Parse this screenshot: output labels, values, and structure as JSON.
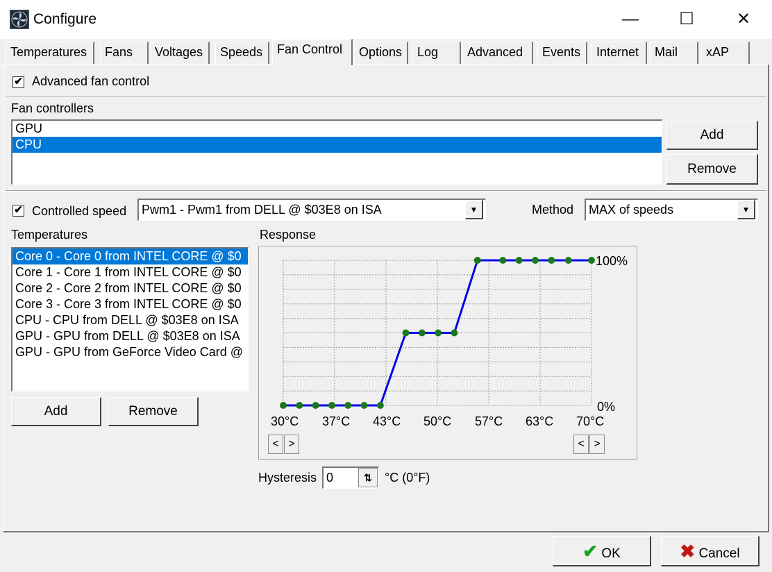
{
  "window": {
    "title": "Configure",
    "min_glyph": "—",
    "max_glyph": "☐",
    "close_glyph": "✕"
  },
  "tabs": [
    {
      "label": "Temperatures"
    },
    {
      "label": "Fans"
    },
    {
      "label": "Voltages"
    },
    {
      "label": "Speeds"
    },
    {
      "label": "Fan Control",
      "active": true
    },
    {
      "label": "Options"
    },
    {
      "label": "Log"
    },
    {
      "label": "Advanced"
    },
    {
      "label": "Events"
    },
    {
      "label": "Internet"
    },
    {
      "label": "Mail"
    },
    {
      "label": "xAP"
    }
  ],
  "advanced": {
    "checked": true,
    "label": "Advanced fan control"
  },
  "fan_controllers": {
    "label": "Fan controllers",
    "items": [
      "GPU",
      "CPU"
    ],
    "selected_index": 1,
    "add_label": "Add",
    "remove_label": "Remove"
  },
  "controlled_speed": {
    "checked": true,
    "label": "Controlled speed",
    "value": "Pwm1 - Pwm1 from DELL @ $03E8 on ISA"
  },
  "method": {
    "label": "Method",
    "value": "MAX of speeds"
  },
  "temperatures": {
    "label": "Temperatures",
    "items": [
      "Core 0 - Core 0 from INTEL CORE @ $0",
      "Core 1 - Core 1 from INTEL CORE @ $0",
      "Core 2 - Core 2 from INTEL CORE @ $0",
      "Core 3 - Core 3 from INTEL CORE @ $0",
      "CPU - CPU from DELL @ $03E8 on ISA",
      "GPU - GPU from DELL @ $03E8 on ISA",
      "GPU - GPU from GeForce Video Card @"
    ],
    "selected_index": 0,
    "add_label": "Add",
    "remove_label": "Remove"
  },
  "response": {
    "label": "Response",
    "y_top_label": "100%",
    "y_bottom_label": "0%",
    "x_tick_labels": [
      "30°C",
      "37°C",
      "43°C",
      "50°C",
      "57°C",
      "63°C",
      "70°C"
    ],
    "left_arrow": "<",
    "right_arrow": ">",
    "line_color": "#0000ee",
    "point_color": "#1a7a1a"
  },
  "chart_data": {
    "type": "line",
    "title": "Response",
    "x_unit": "°C",
    "y_unit": "%",
    "xlim": [
      30,
      70
    ],
    "ylim": [
      0,
      100
    ],
    "grid": true,
    "x_tick_labels": [
      "30°C",
      "37°C",
      "43°C",
      "50°C",
      "57°C",
      "63°C",
      "70°C"
    ],
    "series": [
      {
        "x": [
          30,
          32.1,
          34.2,
          36.3,
          38.4,
          40.5,
          42.6,
          44.7,
          46.8,
          48.9,
          51.0,
          53.1,
          55.2,
          57.3,
          59.4,
          61.5,
          63.6,
          65.8,
          67.9,
          70.0
        ],
        "y": [
          0,
          0,
          0,
          0,
          0,
          0,
          0,
          50,
          50,
          50,
          50,
          50,
          50,
          100,
          100,
          100,
          100,
          100,
          100,
          100
        ],
        "points_x": [
          30,
          32.1,
          34.2,
          36.3,
          38.4,
          40.5,
          42.6,
          45.9,
          48.0,
          50.1,
          52.2,
          55.2,
          58.5,
          60.6,
          62.7,
          64.8,
          67.0,
          70.0
        ],
        "points_y": [
          0,
          0,
          0,
          0,
          0,
          0,
          0,
          50,
          50,
          50,
          50,
          100,
          100,
          100,
          100,
          100,
          100,
          100
        ]
      }
    ]
  },
  "hysteresis": {
    "label": "Hysteresis",
    "value": "0",
    "unit": "°C (0°F)"
  },
  "footer": {
    "ok_label": "OK",
    "cancel_label": "Cancel",
    "ok_color": "#1aa01a",
    "cancel_color": "#c01818"
  }
}
